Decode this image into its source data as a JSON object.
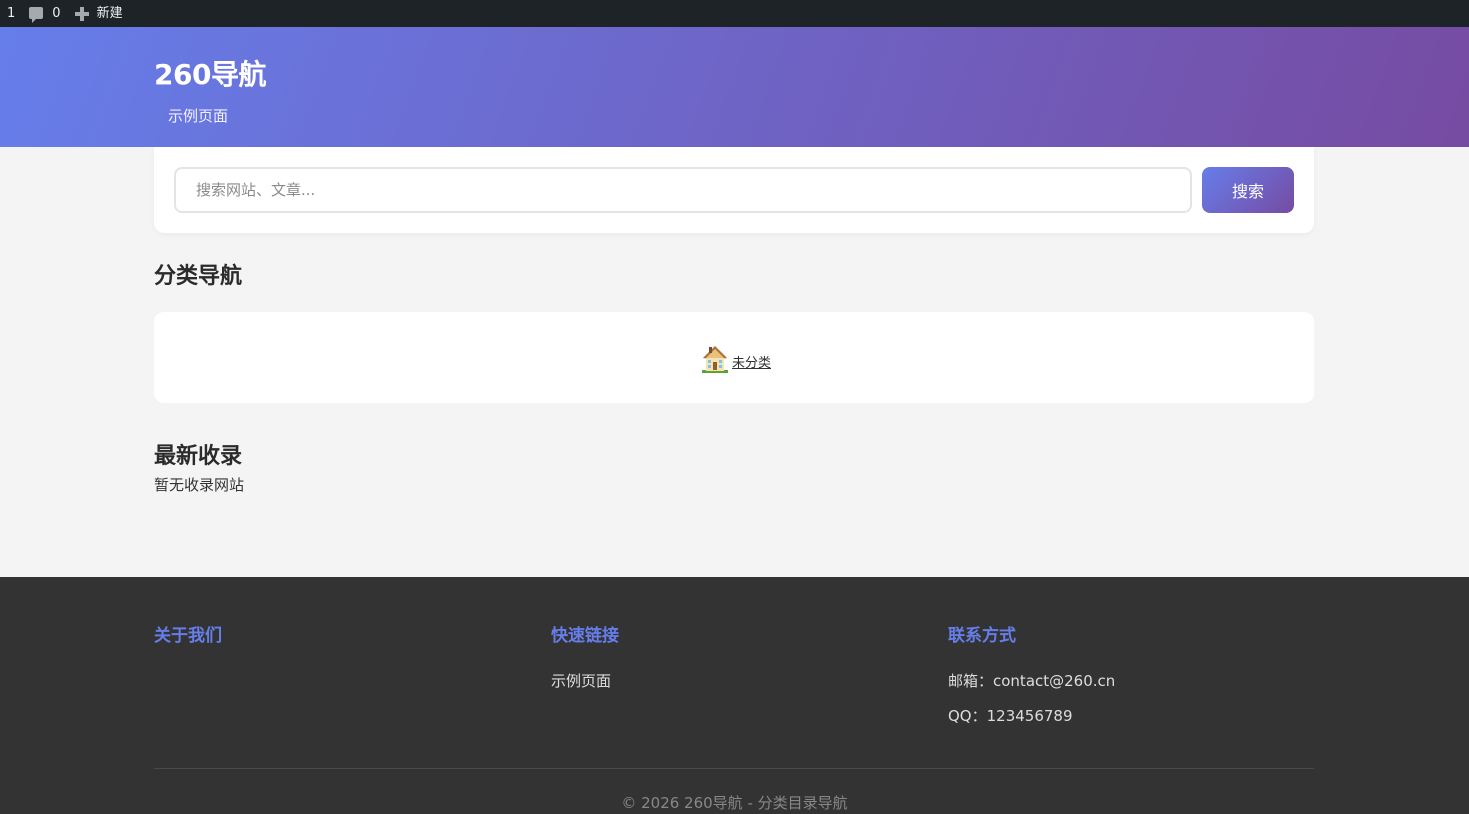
{
  "adminbar": {
    "updates_count": "1",
    "comments_count": "0",
    "new_label": "新建"
  },
  "header": {
    "site_title": "260导航",
    "nav_items": [
      "示例页面"
    ]
  },
  "search": {
    "placeholder": "搜索网站、文章...",
    "button_label": "搜索"
  },
  "categories": {
    "title": "分类导航",
    "items": [
      {
        "label": "未分类",
        "icon": "house-icon"
      }
    ]
  },
  "latest": {
    "title": "最新收录",
    "empty_text": "暂无收录网站"
  },
  "footer": {
    "about": {
      "title": "关于我们"
    },
    "quick_links": {
      "title": "快速链接",
      "items": [
        "示例页面"
      ]
    },
    "contact": {
      "title": "联系方式",
      "email": "邮箱：contact@260.cn",
      "qq": "QQ：123456789"
    },
    "copyright": "© 2026 260导航 - 分类目录导航"
  },
  "colors": {
    "accent_start": "#667eea",
    "accent_end": "#764ba2",
    "adminbar_bg": "#1d2327",
    "footer_bg": "#333333"
  }
}
